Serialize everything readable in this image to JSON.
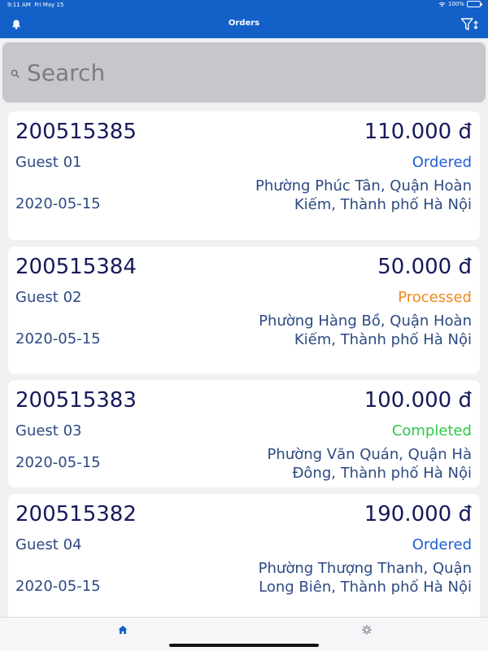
{
  "status_bar": {
    "time": "9:11 AM",
    "date": "Fri May 15",
    "battery": "100%"
  },
  "header": {
    "title": "Orders"
  },
  "search": {
    "placeholder": "Search"
  },
  "orders": [
    {
      "id": "200515385",
      "price": "110.000  đ",
      "guest": "Guest 01",
      "status": "Ordered",
      "status_color": "#1f5fd6",
      "date": "2020-05-15",
      "address": "Phường Phúc Tân, Quận Hoàn Kiếm, Thành phố Hà Nội"
    },
    {
      "id": "200515384",
      "price": "50.000  đ",
      "guest": "Guest 02",
      "status": "Processed",
      "status_color": "#ef8a1e",
      "date": "2020-05-15",
      "address": "Phường Hàng Bồ, Quận Hoàn Kiếm, Thành phố Hà Nội"
    },
    {
      "id": "200515383",
      "price": "100.000  đ",
      "guest": "Guest 03",
      "status": "Completed",
      "status_color": "#2cc94a",
      "date": "2020-05-15",
      "address": "Phường Văn Quán, Quận Hà Đông, Thành phố Hà Nội"
    },
    {
      "id": "200515382",
      "price": "190.000  đ",
      "guest": "Guest 04",
      "status": "Ordered",
      "status_color": "#1f5fd6",
      "date": "2020-05-15",
      "address": "Phường Thượng Thanh, Quận Long Biên, Thành phố Hà Nội"
    }
  ],
  "colors": {
    "primary": "#1361c8",
    "title_text": "#16195a",
    "body_text": "#2c4a82"
  },
  "icons": {
    "header_left": "bell-icon",
    "header_right": "filter-icon",
    "tab_home": "home-icon",
    "tab_settings": "gear-icon"
  }
}
